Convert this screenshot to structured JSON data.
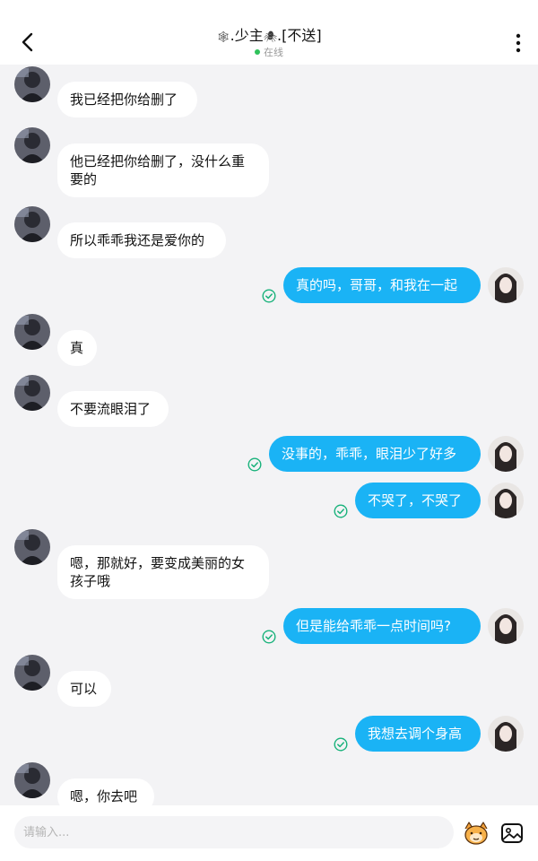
{
  "header": {
    "title_prefix_icon": "spiderweb-icon",
    "title_text": ".少主",
    "title_mid_icon": "spider-icon",
    "title_suffix": ".[不送]",
    "status": "在线",
    "status_color": "#2fc25b"
  },
  "colors": {
    "outgoing_bubble": "#1ab3f5",
    "incoming_bubble": "#ffffff",
    "background": "#f3f3f5",
    "read_check": "#19b27b"
  },
  "messages": [
    {
      "side": "in",
      "text": "我已经把你给删了"
    },
    {
      "side": "in",
      "text": "他已经把你给删了，没什么重要的"
    },
    {
      "side": "in",
      "text": "所以乖乖我还是爱你的"
    },
    {
      "side": "out",
      "text": "真的吗，哥哥，和我在一起",
      "read": true
    },
    {
      "side": "in",
      "text": "真"
    },
    {
      "side": "in",
      "text": "不要流眼泪了"
    },
    {
      "side": "out",
      "text": "没事的，乖乖，眼泪少了好多",
      "read": true
    },
    {
      "side": "out",
      "text": "不哭了，不哭了",
      "read": true
    },
    {
      "side": "in",
      "text": "嗯，那就好，要变成美丽的女孩子哦"
    },
    {
      "side": "out",
      "text": "但是能给乖乖一点时间吗?",
      "read": true
    },
    {
      "side": "in",
      "text": "可以"
    },
    {
      "side": "out",
      "text": "我想去调个身高",
      "read": true
    },
    {
      "side": "in",
      "text": "嗯，你去吧"
    }
  ],
  "footer": {
    "input_placeholder": "请输入...",
    "sticker_icon": "sticker-face-icon",
    "image_icon": "image-icon"
  }
}
